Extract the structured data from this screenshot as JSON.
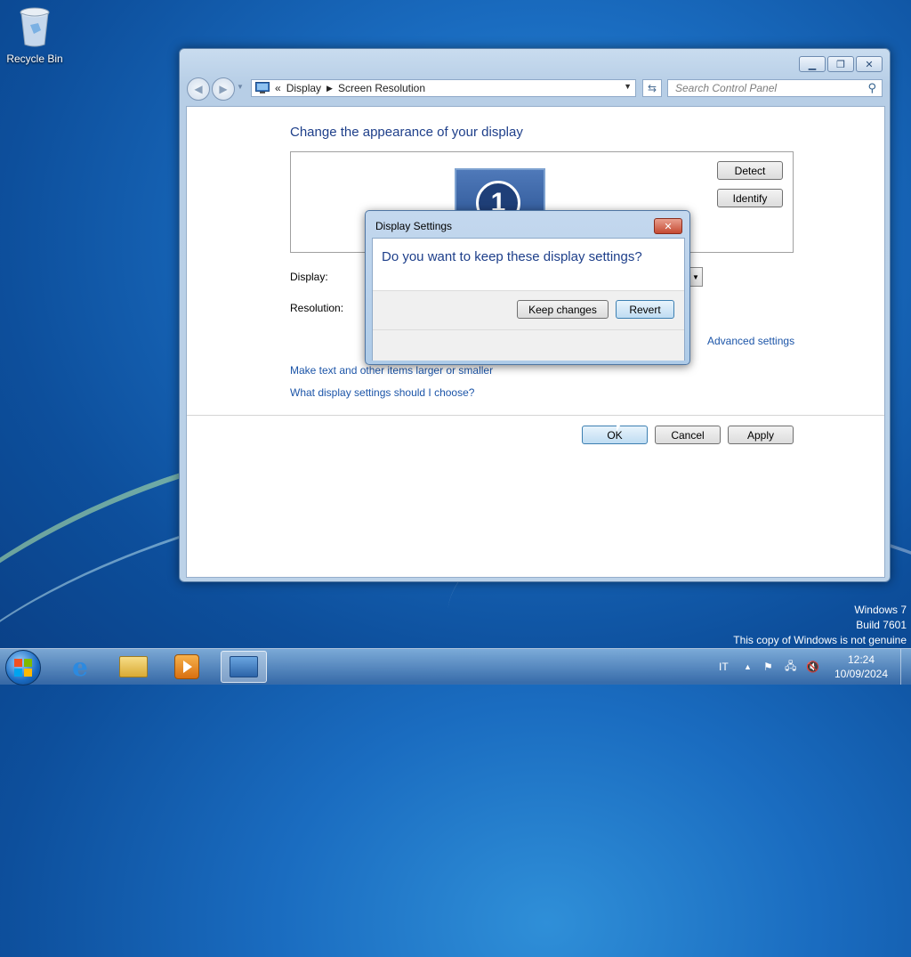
{
  "desktop": {
    "recycle_bin_label": "Recycle Bin"
  },
  "window": {
    "breadcrumb": [
      "«",
      "Display",
      "Screen Resolution"
    ],
    "search_placeholder": "Search Control Panel",
    "heading": "Change the appearance of your display",
    "monitor_number": "1",
    "detect_label": "Detect",
    "identify_label": "Identify",
    "display_label": "Display:",
    "resolution_label": "Resolution:",
    "advanced_link": "Advanced settings",
    "link_text_size": "Make text and other items larger or smaller",
    "link_choose": "What display settings should I choose?",
    "ok_label": "OK",
    "cancel_label": "Cancel",
    "apply_label": "Apply"
  },
  "dialog": {
    "title": "Display Settings",
    "question": "Do you want to keep these display settings?",
    "keep_label": "Keep changes",
    "revert_label": "Revert"
  },
  "watermark": {
    "line1": "Windows 7",
    "line2": "Build 7601",
    "line3": "This copy of Windows is not genuine"
  },
  "taskbar": {
    "language": "IT",
    "time": "12:24",
    "date": "10/09/2024"
  },
  "colors": {
    "accent": "#1e3f8a",
    "link": "#1c55a8"
  }
}
